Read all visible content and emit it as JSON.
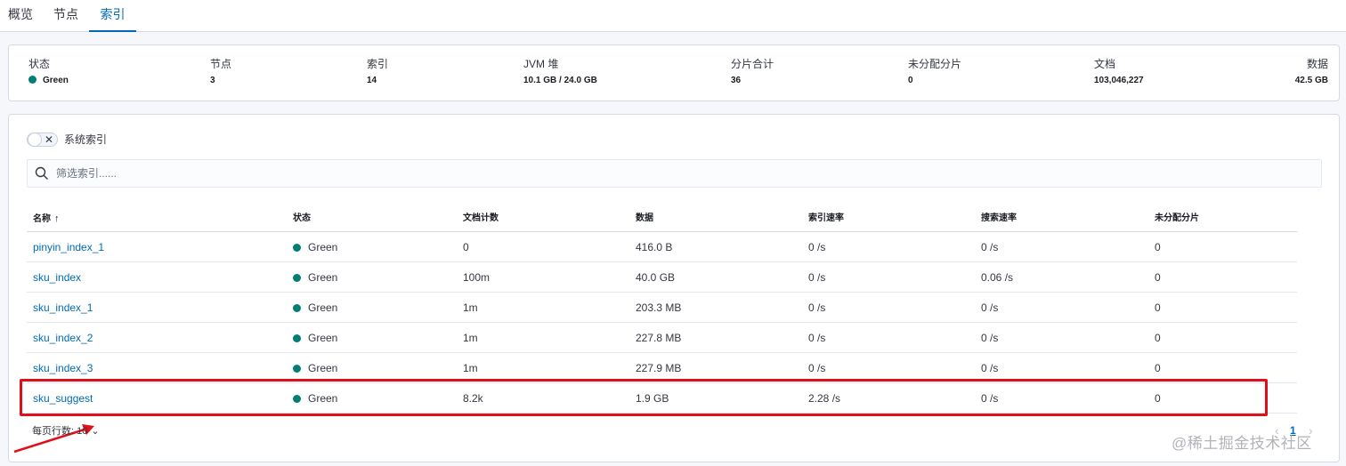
{
  "tabs": [
    {
      "label": "概览"
    },
    {
      "label": "节点"
    },
    {
      "label": "索引",
      "active": true
    }
  ],
  "summary": [
    {
      "label": "状态",
      "value": "Green"
    },
    {
      "label": "节点",
      "value": "3"
    },
    {
      "label": "索引",
      "value": "14"
    },
    {
      "label": "JVM 堆",
      "value": "10.1 GB / 24.0 GB"
    },
    {
      "label": "分片合计",
      "value": "36"
    },
    {
      "label": "未分配分片",
      "value": "0"
    },
    {
      "label": "文档",
      "value": "103,046,227"
    },
    {
      "label": "数据",
      "value": "42.5 GB"
    }
  ],
  "toggle": {
    "label": "系统索引",
    "checked": false
  },
  "search": {
    "placeholder": "筛选索引......"
  },
  "table": {
    "columns": [
      "名称",
      "状态",
      "文档计数",
      "数据",
      "索引速率",
      "搜索速率",
      "未分配分片"
    ],
    "sorted_column": "名称",
    "rows": [
      [
        "pinyin_index_1",
        "Green",
        "0",
        "416.0 B",
        "0 /s",
        "0 /s",
        "0"
      ],
      [
        "sku_index",
        "Green",
        "100m",
        "40.0 GB",
        "0 /s",
        "0.06 /s",
        "0"
      ],
      [
        "sku_index_1",
        "Green",
        "1m",
        "203.3 MB",
        "0 /s",
        "0 /s",
        "0"
      ],
      [
        "sku_index_2",
        "Green",
        "1m",
        "227.8 MB",
        "0 /s",
        "0 /s",
        "0"
      ],
      [
        "sku_index_3",
        "Green",
        "1m",
        "227.9 MB",
        "0 /s",
        "0 /s",
        "0"
      ],
      [
        "sku_suggest",
        "Green",
        "8.2k",
        "1.9 GB",
        "2.28 /s",
        "0 /s",
        "0"
      ]
    ]
  },
  "pagination": {
    "rows_per_page_label": "每页行数: 10",
    "current_page": "1"
  },
  "watermark": "@稀土掘金技术社区",
  "colors": {
    "status_green": "#017d73",
    "link": "#006bb4",
    "highlight": "#e0101b"
  }
}
